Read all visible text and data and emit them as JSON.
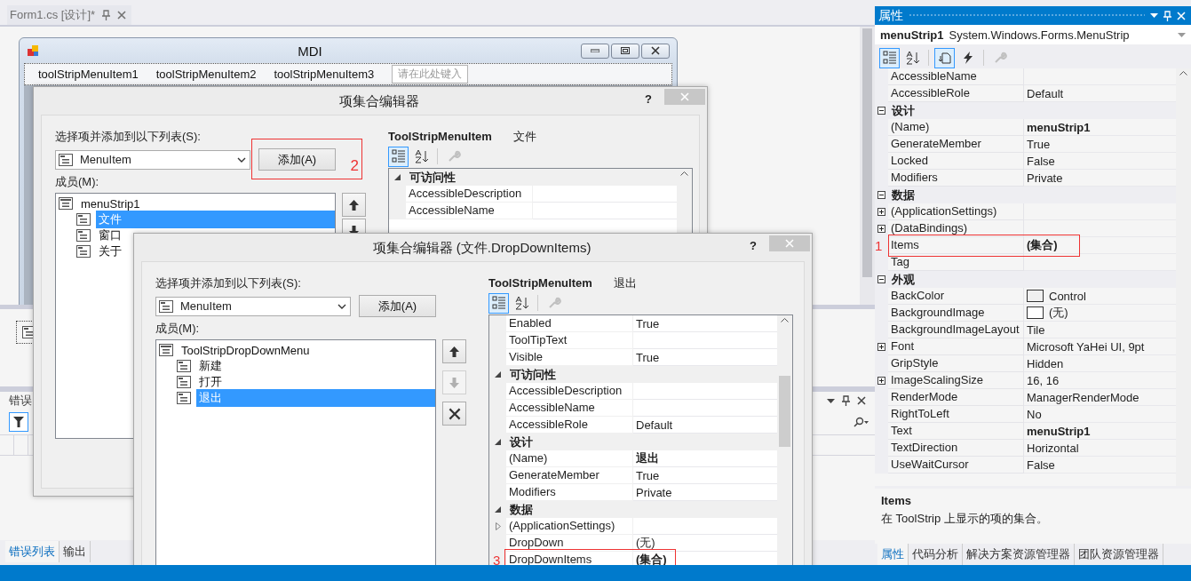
{
  "editor_tab": {
    "label": "Form1.cs [设计]*",
    "selected": false
  },
  "form": {
    "title": "MDI",
    "menu_items": [
      "toolStripMenuItem1",
      "toolStripMenuItem2",
      "toolStripMenuItem3"
    ],
    "type_here": "请在此处键入"
  },
  "error_list": {
    "title": "错误"
  },
  "bottom_tabs": [
    {
      "label": "错误列表",
      "selected": true
    },
    {
      "label": "输出",
      "selected": false
    }
  ],
  "dialogs": [
    {
      "title": "项集合编辑器",
      "help": "?",
      "add_label": "选择项并添加到以下列表(S):",
      "item_type": "MenuItem",
      "add_button": "添加(A)",
      "add_annotation": "2",
      "members_label": "成员(M):",
      "members": [
        {
          "label": "menuStrip1",
          "selected": false,
          "children": [
            {
              "label": "文件",
              "selected": true
            },
            {
              "label": "窗口",
              "selected": false
            },
            {
              "label": "关于",
              "selected": false
            }
          ]
        }
      ],
      "move_buttons": [
        {
          "kind": "up"
        },
        {
          "kind": "down"
        }
      ],
      "object_type": "ToolStripMenuItem",
      "object_name": "文件",
      "toolbar": [
        {
          "kind": "categorized",
          "selected": true,
          "disabled": false
        },
        {
          "kind": "alphabetical",
          "selected": false,
          "disabled": false
        },
        {
          "kind": "pages",
          "selected": false,
          "disabled": true
        }
      ],
      "properties": [
        {
          "kind": "category",
          "label": "可访问性",
          "expanded": true
        },
        {
          "kind": "property",
          "name": "AccessibleDescription"
        },
        {
          "kind": "property",
          "name": "AccessibleName"
        }
      ]
    },
    {
      "title": "项集合编辑器 (文件.DropDownItems)",
      "help": "?",
      "add_label": "选择项并添加到以下列表(S):",
      "item_type": "MenuItem",
      "add_button": "添加(A)",
      "members_label": "成员(M):",
      "members": [
        {
          "label": "ToolStripDropDownMenu",
          "selected": false,
          "children": [
            {
              "label": "新建",
              "selected": false
            },
            {
              "label": "打开",
              "selected": false
            },
            {
              "label": "退出",
              "selected": true
            }
          ]
        }
      ],
      "move_buttons": [
        {
          "kind": "up",
          "disabled": false
        },
        {
          "kind": "down",
          "disabled": true
        },
        {
          "kind": "delete",
          "disabled": false
        }
      ],
      "object_type": "ToolStripMenuItem",
      "object_name": "退出",
      "toolbar": [
        {
          "kind": "categorized",
          "selected": true,
          "disabled": false
        },
        {
          "kind": "alphabetical",
          "selected": false,
          "disabled": false
        },
        {
          "kind": "pages",
          "selected": false,
          "disabled": true
        }
      ],
      "properties": [
        {
          "kind": "property",
          "name": "Enabled",
          "value": "True"
        },
        {
          "kind": "property",
          "name": "ToolTipText"
        },
        {
          "kind": "property",
          "name": "Visible",
          "value": "True"
        },
        {
          "kind": "category",
          "label": "可访问性",
          "expanded": true
        },
        {
          "kind": "property",
          "name": "AccessibleDescription"
        },
        {
          "kind": "property",
          "name": "AccessibleName"
        },
        {
          "kind": "property",
          "name": "AccessibleRole",
          "value": "Default"
        },
        {
          "kind": "category",
          "label": "设计",
          "expanded": true
        },
        {
          "kind": "property",
          "name": "(Name)",
          "value": "退出",
          "bold": true
        },
        {
          "kind": "property",
          "name": "GenerateMember",
          "value": "True"
        },
        {
          "kind": "property",
          "name": "Modifiers",
          "value": "Private"
        },
        {
          "kind": "category",
          "label": "数据",
          "expanded": true
        },
        {
          "kind": "property",
          "name": "(ApplicationSettings)",
          "expandable": true,
          "expanded": false
        },
        {
          "kind": "property",
          "name": "DropDown",
          "value": "(无)"
        },
        {
          "kind": "property",
          "name": "DropDownItems",
          "value": "(集合)",
          "bold": true,
          "annotation": "3"
        }
      ]
    }
  ],
  "properties_panel": {
    "title": "属性",
    "object_name": "menuStrip1",
    "object_type": "System.Windows.Forms.MenuStrip",
    "toolbar": [
      {
        "kind": "categorized",
        "selected": true,
        "disabled": false
      },
      {
        "kind": "alphabetical",
        "selected": false,
        "disabled": false
      },
      {
        "kind": "properties",
        "selected": true,
        "disabled": false
      },
      {
        "kind": "events",
        "selected": false,
        "disabled": false
      },
      {
        "kind": "pages",
        "selected": false,
        "disabled": true
      }
    ],
    "rows": [
      {
        "kind": "property",
        "name": "AccessibleName"
      },
      {
        "kind": "property",
        "name": "AccessibleRole",
        "value": "Default"
      },
      {
        "kind": "category",
        "label": "设计",
        "expanded": true
      },
      {
        "kind": "property",
        "name": "(Name)",
        "value": "menuStrip1",
        "bold": true
      },
      {
        "kind": "property",
        "name": "GenerateMember",
        "value": "True"
      },
      {
        "kind": "property",
        "name": "Locked",
        "value": "False"
      },
      {
        "kind": "property",
        "name": "Modifiers",
        "value": "Private"
      },
      {
        "kind": "category",
        "label": "数据",
        "expanded": true
      },
      {
        "kind": "property",
        "name": "(ApplicationSettings)",
        "expandable": true,
        "expanded": false
      },
      {
        "kind": "property",
        "name": "(DataBindings)",
        "expandable": true,
        "expanded": false
      },
      {
        "kind": "property",
        "name": "Items",
        "value": "(集合)",
        "bold": true,
        "annotation": "1"
      },
      {
        "kind": "property",
        "name": "Tag"
      },
      {
        "kind": "category",
        "label": "外观",
        "expanded": true
      },
      {
        "kind": "property",
        "name": "BackColor",
        "value": "Control",
        "color": "#f0f0f0"
      },
      {
        "kind": "property",
        "name": "BackgroundImage",
        "value": "(无)",
        "color": "#ffffff"
      },
      {
        "kind": "property",
        "name": "BackgroundImageLayout",
        "value": "Tile"
      },
      {
        "kind": "property",
        "name": "Font",
        "value": "Microsoft YaHei UI, 9pt",
        "expandable": true,
        "expanded": false
      },
      {
        "kind": "property",
        "name": "GripStyle",
        "value": "Hidden"
      },
      {
        "kind": "property",
        "name": "ImageScalingSize",
        "value": "16, 16",
        "expandable": true,
        "expanded": false
      },
      {
        "kind": "property",
        "name": "RenderMode",
        "value": "ManagerRenderMode"
      },
      {
        "kind": "property",
        "name": "RightToLeft",
        "value": "No"
      },
      {
        "kind": "property",
        "name": "Text",
        "value": "menuStrip1",
        "bold": true
      },
      {
        "kind": "property",
        "name": "TextDirection",
        "value": "Horizontal"
      },
      {
        "kind": "property",
        "name": "UseWaitCursor",
        "value": "False"
      }
    ],
    "description": {
      "title": "Items",
      "text": "在 ToolStrip 上显示的项的集合。"
    },
    "tabs": [
      {
        "label": "属性",
        "selected": true
      },
      {
        "label": "代码分析",
        "selected": false
      },
      {
        "label": "解决方案资源管理器",
        "selected": false
      },
      {
        "label": "团队资源管理器",
        "selected": false
      }
    ]
  }
}
